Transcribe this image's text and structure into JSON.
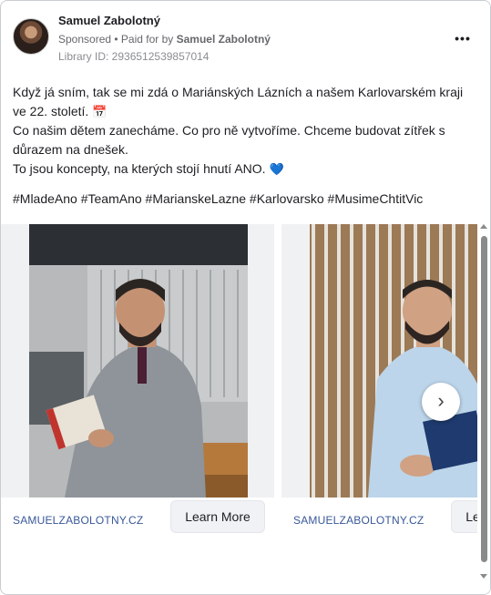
{
  "ad": {
    "advertiser_name": "Samuel Zabolotný",
    "sponsored_label": "Sponsored",
    "paid_for_prefix": " • Paid for by ",
    "paid_for_name": "Samuel Zabolotný",
    "library_id": "Library ID: 2936512539857014",
    "more_icon": "•••"
  },
  "body": {
    "line1": "Když já sním, tak se mi zdá o Mariánských Lázních a našem Karlovarském kraji ve 22. století.",
    "emoji1": "📅",
    "line2": "Co našim dětem zanecháme. Co pro ně vytvoříme. Chceme budovat zítřek s důrazem na dnešek.",
    "line3": "To jsou koncepty, na kterých stojí hnutí ANO.",
    "emoji3": "💙",
    "hashtags": "#MladeAno #TeamAno #MarianskeLazne #Karlovarsko #MusimeChtitVic"
  },
  "carousel": {
    "slides": [
      {
        "domain": "SAMUELZABOLOTNY.CZ",
        "cta": "Learn More"
      },
      {
        "domain": "SAMUELZABOLOTNY.CZ",
        "cta": "Learn More"
      }
    ],
    "next_icon": "›"
  },
  "colors": {
    "link": "#385898",
    "text": "#1c1e21",
    "muted": "#65676b",
    "button_bg": "#f0f2f5"
  }
}
